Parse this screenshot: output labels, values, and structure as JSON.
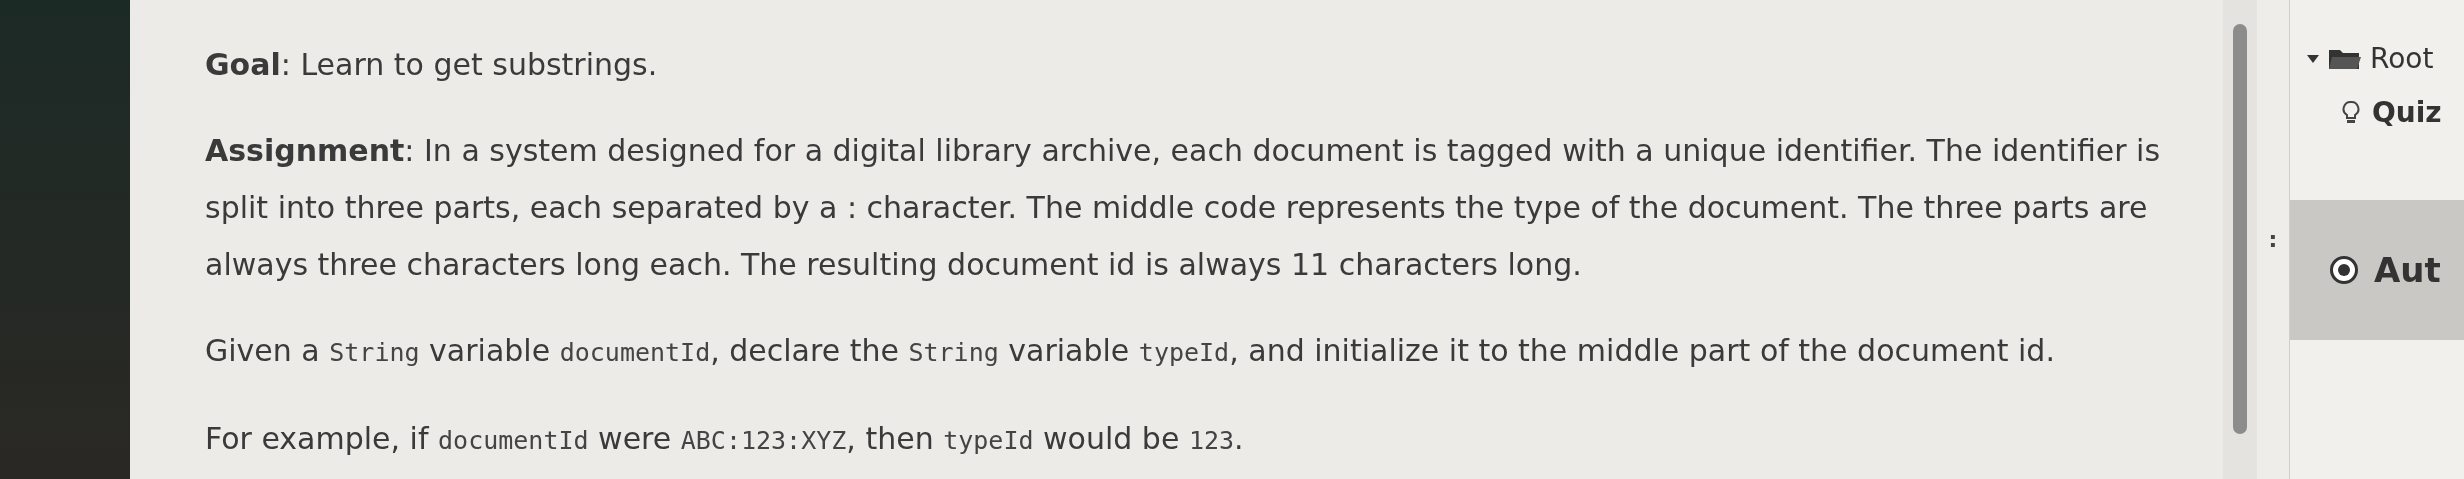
{
  "content": {
    "paragraphs": [
      [
        {
          "kind": "bold",
          "text": "Goal"
        },
        {
          "kind": "text",
          "text": ": Learn to get substrings."
        }
      ],
      [
        {
          "kind": "bold",
          "text": "Assignment"
        },
        {
          "kind": "text",
          "text": ": In a system designed for a digital library archive, each document is tagged with a unique identifier. The identifier is split into three parts, each separated by a : character. The middle code represents the type of the document. The three parts are always three characters long each. The resulting document id is always 11 characters long."
        }
      ],
      [
        {
          "kind": "text",
          "text": "Given a "
        },
        {
          "kind": "code",
          "text": "String"
        },
        {
          "kind": "text",
          "text": " variable "
        },
        {
          "kind": "code",
          "text": "documentId"
        },
        {
          "kind": "text",
          "text": ", declare the "
        },
        {
          "kind": "code",
          "text": "String"
        },
        {
          "kind": "text",
          "text": " variable "
        },
        {
          "kind": "code",
          "text": "typeId"
        },
        {
          "kind": "text",
          "text": ", and initialize it to the middle part of the document id."
        }
      ],
      [
        {
          "kind": "text",
          "text": "For example, if "
        },
        {
          "kind": "code",
          "text": "documentId"
        },
        {
          "kind": "text",
          "text": " were "
        },
        {
          "kind": "code",
          "text": "ABC:123:XYZ"
        },
        {
          "kind": "text",
          "text": ", then "
        },
        {
          "kind": "code",
          "text": "typeId"
        },
        {
          "kind": "text",
          "text": " would be "
        },
        {
          "kind": "code",
          "text": "123"
        },
        {
          "kind": "text",
          "text": "."
        }
      ]
    ]
  },
  "splitter": {
    "grip": ":"
  },
  "tree": [
    {
      "label": "Root",
      "expanded": true,
      "children": [
        {
          "label": "Quiz",
          "bold": true
        }
      ]
    }
  ],
  "mode": {
    "label": "Aut",
    "selected": true
  }
}
